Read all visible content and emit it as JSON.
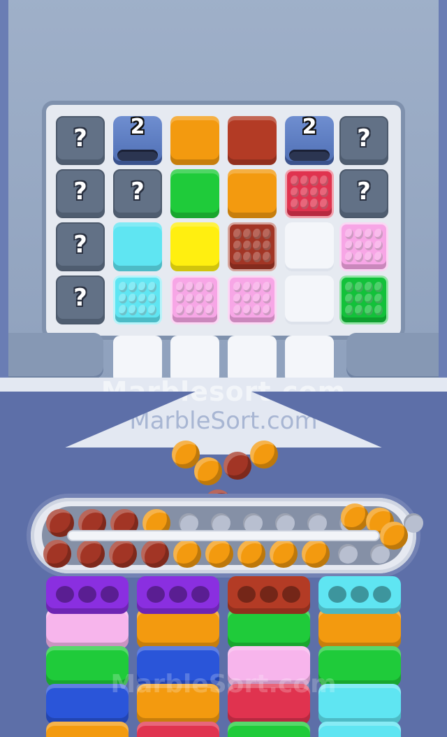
{
  "game": {
    "name": "marble-sort-puzzle",
    "watermarks": [
      "Marblesort.com",
      "MarbleSort.com",
      "MarbleSort.com"
    ],
    "colors": {
      "orange": "#f39a0f",
      "brown": "#a23525",
      "green": "#1fcb3a",
      "yellow": "#ffef10",
      "cyan": "#5fe5f2",
      "red": "#e0334f",
      "pink": "#f7a6e6",
      "purple": "#8a2fe0",
      "blue": "#2a55d9",
      "lightpink": "#f7b5ec",
      "darkbrown": "#b33b25",
      "darkgreen": "#13c13a"
    }
  },
  "board": {
    "rows": [
      [
        {
          "type": "mystery",
          "label": "?"
        },
        {
          "type": "pipe",
          "count": "2"
        },
        {
          "type": "solid",
          "color": "orange"
        },
        {
          "type": "solid",
          "color": "darkbrown"
        },
        {
          "type": "pipe",
          "count": "2"
        },
        {
          "type": "mystery",
          "label": "?"
        }
      ],
      [
        {
          "type": "mystery",
          "label": "?"
        },
        {
          "type": "mystery",
          "label": "?"
        },
        {
          "type": "solid",
          "color": "green"
        },
        {
          "type": "solid",
          "color": "orange"
        },
        {
          "type": "studs",
          "color": "red"
        },
        {
          "type": "mystery",
          "label": "?"
        }
      ],
      [
        {
          "type": "mystery",
          "label": "?"
        },
        {
          "type": "solid",
          "color": "cyan"
        },
        {
          "type": "solid",
          "color": "yellow"
        },
        {
          "type": "studs",
          "color": "brown"
        },
        {
          "type": "empty"
        },
        {
          "type": "studs",
          "color": "pink"
        }
      ],
      [
        {
          "type": "mystery",
          "label": "?"
        },
        {
          "type": "studs",
          "color": "cyan"
        },
        {
          "type": "studs",
          "color": "pink"
        },
        {
          "type": "studs",
          "color": "pink"
        },
        {
          "type": "empty"
        },
        {
          "type": "studs",
          "color": "darkgreen"
        }
      ],
      [
        {
          "type": "none"
        },
        {
          "type": "empty"
        },
        {
          "type": "empty"
        },
        {
          "type": "empty"
        },
        {
          "type": "empty"
        },
        {
          "type": "none"
        }
      ]
    ]
  },
  "funnel_marbles": [
    "orange",
    "orange",
    "brown",
    "orange",
    "brown"
  ],
  "conveyor": {
    "top_lane": [
      "brown",
      "brown",
      "brown",
      "orange",
      "empty",
      "empty",
      "empty",
      "empty",
      "empty",
      "empty",
      "empty",
      "empty",
      "orange",
      "orange"
    ],
    "bottom_lane": [
      "brown",
      "brown",
      "brown",
      "brown",
      "orange",
      "orange",
      "orange",
      "orange",
      "orange",
      "empty",
      "empty"
    ],
    "right_end": "orange"
  },
  "columns": [
    {
      "head": "purple",
      "blocks": [
        "lightpink",
        "green",
        "blue",
        "orange"
      ]
    },
    {
      "head": "purple",
      "blocks": [
        "orange",
        "blue",
        "orange",
        "red"
      ]
    },
    {
      "head": "darkbrown",
      "blocks": [
        "green",
        "lightpink",
        "red",
        "green"
      ]
    },
    {
      "head": "cyan",
      "blocks": [
        "orange",
        "green",
        "cyan",
        "cyan"
      ]
    }
  ]
}
